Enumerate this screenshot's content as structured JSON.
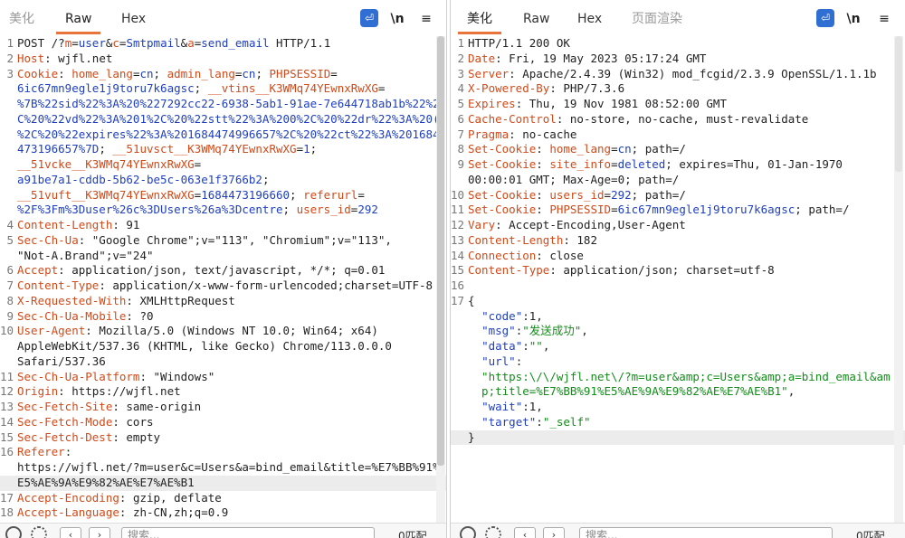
{
  "request_panel": {
    "tabs": [
      {
        "label": "美化"
      },
      {
        "label": "Raw"
      },
      {
        "label": "Hex"
      }
    ],
    "toolbar": {
      "newline_label": "\\n",
      "menu_label": "≡"
    },
    "lines": [
      {
        "n": "1",
        "segs": [
          [
            "p",
            "POST /?"
          ],
          [
            "k",
            "m"
          ],
          [
            "p",
            "="
          ],
          [
            "v",
            "user"
          ],
          [
            "p",
            "&"
          ],
          [
            "k",
            "c"
          ],
          [
            "p",
            "="
          ],
          [
            "v",
            "Smtpmail"
          ],
          [
            "p",
            "&"
          ],
          [
            "k",
            "a"
          ],
          [
            "p",
            "="
          ],
          [
            "v",
            "send_email"
          ],
          [
            "p",
            " HTTP/1.1"
          ]
        ]
      },
      {
        "n": "2",
        "segs": [
          [
            "k",
            "Host"
          ],
          [
            "p",
            ": wjfl.net"
          ]
        ]
      },
      {
        "n": "3",
        "segs": [
          [
            "k",
            "Cookie"
          ],
          [
            "p",
            ": "
          ],
          [
            "k",
            "home_lang"
          ],
          [
            "p",
            "="
          ],
          [
            "v",
            "cn"
          ],
          [
            "p",
            "; "
          ],
          [
            "k",
            "admin_lang"
          ],
          [
            "p",
            "="
          ],
          [
            "v",
            "cn"
          ],
          [
            "p",
            "; "
          ],
          [
            "k",
            "PHPSESSID"
          ],
          [
            "p",
            "="
          ]
        ]
      },
      {
        "n": "",
        "segs": [
          [
            "v",
            "6ic67mn9egle1j9toru7k6agsc"
          ],
          [
            "p",
            "; "
          ],
          [
            "k",
            "__vtins__K3WMq74YEwnxRwXG"
          ],
          [
            "p",
            "="
          ]
        ]
      },
      {
        "n": "",
        "segs": [
          [
            "v",
            "%7B%22sid%22%3A%20%227292cc22-6938-5ab1-91ae-7e644718ab1b%22%2"
          ]
        ]
      },
      {
        "n": "",
        "segs": [
          [
            "v",
            "C%20%22vd%22%3A%201%2C%20%22stt%22%3A%200%2C%20%22dr%22%3A%20("
          ]
        ]
      },
      {
        "n": "",
        "segs": [
          [
            "v",
            "%2C%20%22expires%22%3A%201684474996657%2C%20%22ct%22%3A%201684"
          ]
        ]
      },
      {
        "n": "",
        "segs": [
          [
            "v",
            "473196657%7D"
          ],
          [
            "p",
            "; "
          ],
          [
            "k",
            "__51uvsct__K3WMq74YEwnxRwXG"
          ],
          [
            "p",
            "="
          ],
          [
            "v",
            "1"
          ],
          [
            "p",
            ";"
          ]
        ]
      },
      {
        "n": "",
        "segs": [
          [
            "k",
            "__51vcke__K3WMq74YEwnxRwXG"
          ],
          [
            "p",
            "="
          ]
        ]
      },
      {
        "n": "",
        "segs": [
          [
            "v",
            "a91be7a1-cddb-5b62-be5c-063e1f3766b2"
          ],
          [
            "p",
            ";"
          ]
        ]
      },
      {
        "n": "",
        "segs": [
          [
            "k",
            "__51vuft__K3WMq74YEwnxRwXG"
          ],
          [
            "p",
            "="
          ],
          [
            "v",
            "1684473196660"
          ],
          [
            "p",
            "; "
          ],
          [
            "k",
            "referurl"
          ],
          [
            "p",
            "="
          ]
        ]
      },
      {
        "n": "",
        "segs": [
          [
            "v",
            "%2F%3Fm%3Duser%26c%3DUsers%26a%3Dcentre"
          ],
          [
            "p",
            "; "
          ],
          [
            "k",
            "users_id"
          ],
          [
            "p",
            "="
          ],
          [
            "v",
            "292"
          ]
        ]
      },
      {
        "n": "4",
        "segs": [
          [
            "k",
            "Content-Length"
          ],
          [
            "p",
            ": 91"
          ]
        ]
      },
      {
        "n": "5",
        "segs": [
          [
            "k",
            "Sec-Ch-Ua"
          ],
          [
            "p",
            ": \"Google Chrome\";v=\"113\", \"Chromium\";v=\"113\","
          ]
        ]
      },
      {
        "n": "",
        "segs": [
          [
            "p",
            "\"Not-A.Brand\";v=\"24\""
          ]
        ]
      },
      {
        "n": "6",
        "segs": [
          [
            "k",
            "Accept"
          ],
          [
            "p",
            ": application/json, text/javascript, */*; q=0.01"
          ]
        ]
      },
      {
        "n": "7",
        "segs": [
          [
            "k",
            "Content-Type"
          ],
          [
            "p",
            ": application/x-www-form-urlencoded;charset=UTF-8"
          ]
        ]
      },
      {
        "n": "8",
        "segs": [
          [
            "k",
            "X-Requested-With"
          ],
          [
            "p",
            ": XMLHttpRequest"
          ]
        ]
      },
      {
        "n": "9",
        "segs": [
          [
            "k",
            "Sec-Ch-Ua-Mobile"
          ],
          [
            "p",
            ": ?0"
          ]
        ]
      },
      {
        "n": "10",
        "segs": [
          [
            "k",
            "User-Agent"
          ],
          [
            "p",
            ": Mozilla/5.0 (Windows NT 10.0; Win64; x64)"
          ]
        ]
      },
      {
        "n": "",
        "segs": [
          [
            "p",
            "AppleWebKit/537.36 (KHTML, like Gecko) Chrome/113.0.0.0"
          ]
        ]
      },
      {
        "n": "",
        "segs": [
          [
            "p",
            "Safari/537.36"
          ]
        ]
      },
      {
        "n": "11",
        "segs": [
          [
            "k",
            "Sec-Ch-Ua-Platform"
          ],
          [
            "p",
            ": \"Windows\""
          ]
        ]
      },
      {
        "n": "12",
        "segs": [
          [
            "k",
            "Origin"
          ],
          [
            "p",
            ": https://wjfl.net"
          ]
        ]
      },
      {
        "n": "13",
        "segs": [
          [
            "k",
            "Sec-Fetch-Site"
          ],
          [
            "p",
            ": same-origin"
          ]
        ]
      },
      {
        "n": "14",
        "segs": [
          [
            "k",
            "Sec-Fetch-Mode"
          ],
          [
            "p",
            ": cors"
          ]
        ]
      },
      {
        "n": "15",
        "segs": [
          [
            "k",
            "Sec-Fetch-Dest"
          ],
          [
            "p",
            ": empty"
          ]
        ]
      },
      {
        "n": "16",
        "segs": [
          [
            "k",
            "Referer"
          ],
          [
            "p",
            ":"
          ]
        ]
      },
      {
        "n": "",
        "segs": [
          [
            "p",
            "https://wjfl.net/?m=user&c=Users&a=bind_email&title=%E7%BB%91%"
          ]
        ]
      },
      {
        "n": "",
        "hl": true,
        "segs": [
          [
            "p",
            "E5%AE%9A%E9%82%AE%E7%AE%B1"
          ]
        ]
      },
      {
        "n": "17",
        "segs": [
          [
            "k",
            "Accept-Encoding"
          ],
          [
            "p",
            ": gzip, deflate"
          ]
        ]
      },
      {
        "n": "18",
        "segs": [
          [
            "k",
            "Accept-Language"
          ],
          [
            "p",
            ": zh-CN,zh;q=0.9"
          ]
        ]
      }
    ],
    "bottom": {
      "search_placeholder": "搜索...",
      "match_count": "0匹配"
    }
  },
  "response_panel": {
    "tabs": [
      {
        "label": "美化"
      },
      {
        "label": "Raw"
      },
      {
        "label": "Hex"
      },
      {
        "label": "页面渲染"
      }
    ],
    "toolbar": {
      "newline_label": "\\n",
      "menu_label": "≡"
    },
    "lines": [
      {
        "n": "1",
        "segs": [
          [
            "p",
            "HTTP/1.1 200 OK"
          ]
        ]
      },
      {
        "n": "2",
        "segs": [
          [
            "k",
            "Date"
          ],
          [
            "p",
            ": Fri, 19 May 2023 05:17:24 GMT"
          ]
        ]
      },
      {
        "n": "3",
        "segs": [
          [
            "k",
            "Server"
          ],
          [
            "p",
            ": Apache/2.4.39 (Win32) mod_fcgid/2.3.9 OpenSSL/1.1.1b"
          ]
        ]
      },
      {
        "n": "4",
        "segs": [
          [
            "k",
            "X-Powered-By"
          ],
          [
            "p",
            ": PHP/7.3.6"
          ]
        ]
      },
      {
        "n": "5",
        "segs": [
          [
            "k",
            "Expires"
          ],
          [
            "p",
            ": Thu, 19 Nov 1981 08:52:00 GMT"
          ]
        ]
      },
      {
        "n": "6",
        "segs": [
          [
            "k",
            "Cache-Control"
          ],
          [
            "p",
            ": no-store, no-cache, must-revalidate"
          ]
        ]
      },
      {
        "n": "7",
        "segs": [
          [
            "k",
            "Pragma"
          ],
          [
            "p",
            ": no-cache"
          ]
        ]
      },
      {
        "n": "8",
        "segs": [
          [
            "k",
            "Set-Cookie"
          ],
          [
            "p",
            ": "
          ],
          [
            "k",
            "home_lang"
          ],
          [
            "p",
            "="
          ],
          [
            "v",
            "cn"
          ],
          [
            "p",
            "; path=/"
          ]
        ]
      },
      {
        "n": "9",
        "segs": [
          [
            "k",
            "Set-Cookie"
          ],
          [
            "p",
            ": "
          ],
          [
            "k",
            "site_info"
          ],
          [
            "p",
            "="
          ],
          [
            "v",
            "deleted"
          ],
          [
            "p",
            "; expires=Thu, 01-Jan-1970"
          ]
        ]
      },
      {
        "n": "",
        "segs": [
          [
            "p",
            "00:00:01 GMT; Max-Age=0; path=/"
          ]
        ]
      },
      {
        "n": "10",
        "segs": [
          [
            "k",
            "Set-Cookie"
          ],
          [
            "p",
            ": "
          ],
          [
            "k",
            "users_id"
          ],
          [
            "p",
            "="
          ],
          [
            "v",
            "292"
          ],
          [
            "p",
            "; path=/"
          ]
        ]
      },
      {
        "n": "11",
        "segs": [
          [
            "k",
            "Set-Cookie"
          ],
          [
            "p",
            ": "
          ],
          [
            "k",
            "PHPSESSID"
          ],
          [
            "p",
            "="
          ],
          [
            "v",
            "6ic67mn9egle1j9toru7k6agsc"
          ],
          [
            "p",
            "; path=/"
          ]
        ]
      },
      {
        "n": "12",
        "segs": [
          [
            "k",
            "Vary"
          ],
          [
            "p",
            ": Accept-Encoding,User-Agent"
          ]
        ]
      },
      {
        "n": "13",
        "segs": [
          [
            "k",
            "Content-Length"
          ],
          [
            "p",
            ": 182"
          ]
        ]
      },
      {
        "n": "14",
        "segs": [
          [
            "k",
            "Connection"
          ],
          [
            "p",
            ": close"
          ]
        ]
      },
      {
        "n": "15",
        "segs": [
          [
            "k",
            "Content-Type"
          ],
          [
            "p",
            ": application/json; charset=utf-8"
          ]
        ]
      },
      {
        "n": "16",
        "segs": [
          [
            "p",
            ""
          ]
        ]
      },
      {
        "n": "17",
        "segs": [
          [
            "p",
            "{"
          ]
        ]
      },
      {
        "n": "",
        "segs": [
          [
            "p",
            "  "
          ],
          [
            "v",
            "\"code\""
          ],
          [
            "p",
            ":1,"
          ]
        ]
      },
      {
        "n": "",
        "segs": [
          [
            "p",
            "  "
          ],
          [
            "v",
            "\"msg\""
          ],
          [
            "p",
            ":"
          ],
          [
            "s",
            "\"发送成功\""
          ],
          [
            "p",
            ","
          ]
        ]
      },
      {
        "n": "",
        "segs": [
          [
            "p",
            "  "
          ],
          [
            "v",
            "\"data\""
          ],
          [
            "p",
            ":"
          ],
          [
            "s",
            "\"\""
          ],
          [
            "p",
            ","
          ]
        ]
      },
      {
        "n": "",
        "segs": [
          [
            "p",
            "  "
          ],
          [
            "v",
            "\"url\""
          ],
          [
            "p",
            ":"
          ]
        ]
      },
      {
        "n": "",
        "segs": [
          [
            "s",
            "  \"https:\\/\\/wjfl.net\\/?m=user&amp;c=Users&amp;a=bind_email&am"
          ]
        ]
      },
      {
        "n": "",
        "segs": [
          [
            "s",
            "  p;title=%E7%BB%91%E5%AE%9A%E9%82%AE%E7%AE%B1\""
          ],
          [
            "p",
            ","
          ]
        ]
      },
      {
        "n": "",
        "segs": [
          [
            "p",
            "  "
          ],
          [
            "v",
            "\"wait\""
          ],
          [
            "p",
            ":1,"
          ]
        ]
      },
      {
        "n": "",
        "segs": [
          [
            "p",
            "  "
          ],
          [
            "v",
            "\"target\""
          ],
          [
            "p",
            ":"
          ],
          [
            "s",
            "\"_self\""
          ]
        ]
      },
      {
        "n": "",
        "hl": true,
        "segs": [
          [
            "p",
            "}"
          ]
        ]
      }
    ],
    "bottom": {
      "search_placeholder": "搜索...",
      "match_count": "0匹配"
    }
  }
}
